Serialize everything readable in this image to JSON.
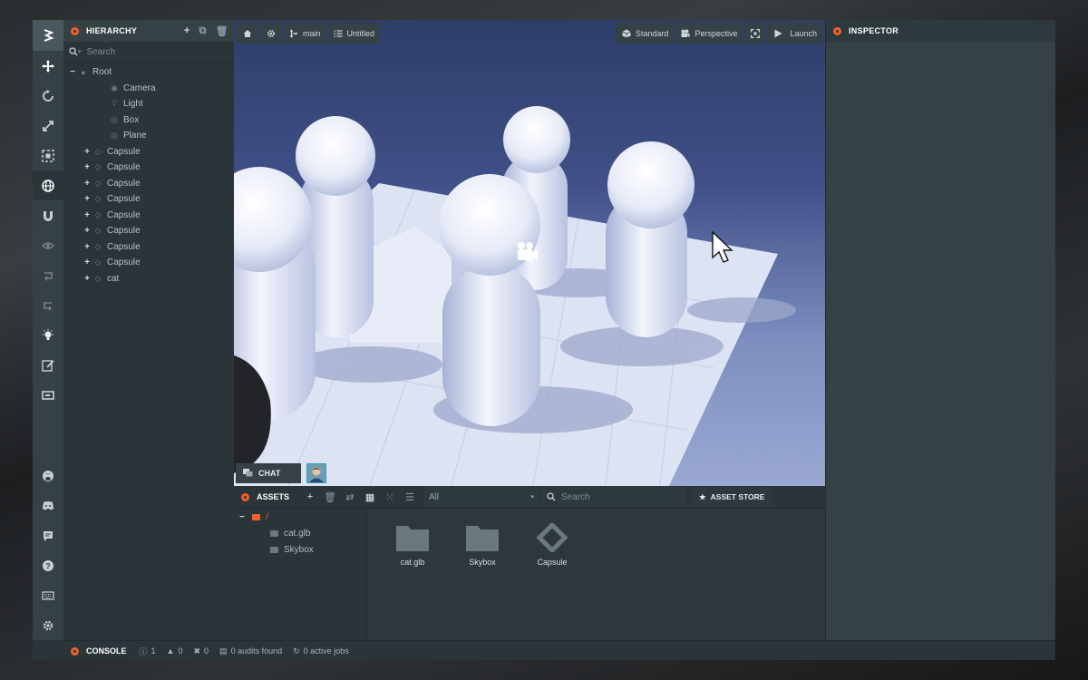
{
  "hierarchy": {
    "title": "HIERARCHY",
    "search_placeholder": "Search",
    "items": [
      {
        "label": "Root",
        "expander": "−",
        "icon": "circle-icon"
      },
      {
        "label": "Camera",
        "expander": "",
        "icon": "camera-icon"
      },
      {
        "label": "Light",
        "expander": "",
        "icon": "lightbulb-icon"
      },
      {
        "label": "Box",
        "expander": "",
        "icon": "mesh-icon"
      },
      {
        "label": "Plane",
        "expander": "",
        "icon": "mesh-icon"
      },
      {
        "label": "Capsule",
        "expander": "+",
        "icon": "diamond-icon"
      },
      {
        "label": "Capsule",
        "expander": "+",
        "icon": "diamond-icon"
      },
      {
        "label": "Capsule",
        "expander": "+",
        "icon": "diamond-icon"
      },
      {
        "label": "Capsule",
        "expander": "+",
        "icon": "diamond-icon"
      },
      {
        "label": "Capsule",
        "expander": "+",
        "icon": "diamond-icon"
      },
      {
        "label": "Capsule",
        "expander": "+",
        "icon": "diamond-icon"
      },
      {
        "label": "Capsule",
        "expander": "+",
        "icon": "diamond-icon"
      },
      {
        "label": "Capsule",
        "expander": "+",
        "icon": "diamond-icon"
      },
      {
        "label": "cat",
        "expander": "+",
        "icon": "diamond-icon"
      }
    ]
  },
  "viewport": {
    "branch": "main",
    "scene": "Untitled",
    "shading": "Standard",
    "projection": "Perspective",
    "launch": "Launch",
    "chat": "CHAT"
  },
  "inspector": {
    "title": "INSPECTOR"
  },
  "assets": {
    "title": "ASSETS",
    "filter": "All",
    "search_placeholder": "Search",
    "store": "ASSET STORE",
    "tree": [
      {
        "label": "/",
        "expander": "−"
      },
      {
        "label": "cat.glb",
        "expander": ""
      },
      {
        "label": "Skybox",
        "expander": ""
      }
    ],
    "items": [
      {
        "label": "cat.glb",
        "icon": "folder-icon"
      },
      {
        "label": "Skybox",
        "icon": "folder-icon"
      },
      {
        "label": "Capsule",
        "icon": "template-icon"
      }
    ]
  },
  "console": {
    "title": "CONSOLE",
    "info": "1",
    "warnings": "0",
    "errors": "0",
    "audits": "0 audits found",
    "jobs": "0 active jobs"
  },
  "colors": {
    "accent": "#f0602a",
    "panel": "#2b3539",
    "panel_light": "#364146",
    "sky_top": "#2e3d68"
  }
}
